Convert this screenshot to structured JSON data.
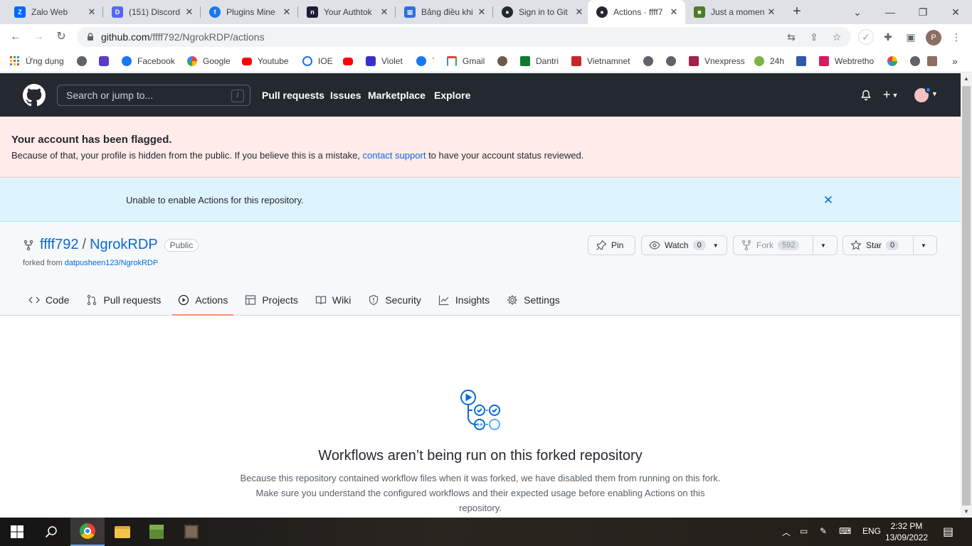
{
  "browser": {
    "tabs": [
      {
        "title": "Zalo Web",
        "icon": "zalo-icon",
        "color": "#0068ff"
      },
      {
        "title": "(151) Discord",
        "icon": "discord-icon",
        "color": "#5865f2"
      },
      {
        "title": "Plugins Mine",
        "icon": "facebook-icon",
        "color": "#1877f2"
      },
      {
        "title": "Your Authtok",
        "icon": "ngrok-icon",
        "color": "#1f1e37"
      },
      {
        "title": "Bảng điều khi",
        "icon": "dashboard-icon",
        "color": "#2f6fd8"
      },
      {
        "title": "Sign in to Git",
        "icon": "github-icon",
        "color": "#24292f"
      },
      {
        "title": "Actions · ffff7",
        "icon": "github-icon",
        "color": "#24292f"
      },
      {
        "title": "Just a momen",
        "icon": "minecraft-icon",
        "color": "#4e7a2a"
      }
    ],
    "url_host": "github.com",
    "url_path": "/ffff792/NgrokRDP/actions",
    "profile_initial": "P",
    "bookmarks": [
      {
        "label": "Ứng dụng",
        "color": "#e8453c"
      },
      {
        "label": "",
        "color": "#5f6368"
      },
      {
        "label": "",
        "color": "#5b3cc4"
      },
      {
        "label": "Facebook",
        "color": "#1877f2"
      },
      {
        "label": "Google",
        "color": "#4285f4"
      },
      {
        "label": "Youtube",
        "color": "#ff0000"
      },
      {
        "label": "IOE",
        "color": "#1a73e8"
      },
      {
        "label": "",
        "color": "#ff0000"
      },
      {
        "label": "Violet",
        "color": "#3b2fc9"
      },
      {
        "label": "`",
        "color": "#1877f2"
      },
      {
        "label": "Gmail",
        "color": "#ea4335"
      },
      {
        "label": "",
        "color": "#6d5a4a"
      },
      {
        "label": "Dantri",
        "color": "#0d7a2e"
      },
      {
        "label": "Vietnamnet",
        "color": "#c62828"
      },
      {
        "label": "",
        "color": "#5f6368"
      },
      {
        "label": "",
        "color": "#5f6368"
      },
      {
        "label": "Vnexpress",
        "color": "#9f224e"
      },
      {
        "label": "24h",
        "color": "#7cb342"
      },
      {
        "label": "",
        "color": "#2e5aa8"
      },
      {
        "label": "Webtretho",
        "color": "#d81b60"
      },
      {
        "label": "",
        "color": "#fbbc05"
      },
      {
        "label": "",
        "color": "#5f6368"
      },
      {
        "label": "",
        "color": "#8d6e63"
      }
    ]
  },
  "github": {
    "search_placeholder": "Search or jump to...",
    "search_key": "/",
    "nav": [
      "Pull requests",
      "Issues",
      "Marketplace",
      "Explore"
    ],
    "flagged_title": "Your account has been flagged.",
    "flagged_text_before": "Because of that, your profile is hidden from the public. If you believe this is a mistake,",
    "flagged_link": "contact support",
    "flagged_text_after": "to have your account status reviewed.",
    "actions_notice": "Unable to enable Actions for this repository.",
    "repo": {
      "owner": "ffff792",
      "separator": "/",
      "name": "NgrokRDP",
      "visibility": "Public",
      "forked_prefix": "forked from",
      "forked_source": "datpusheen123/NgrokRDP"
    },
    "buttons": {
      "pin": "Pin",
      "watch": "Watch",
      "watch_count": "0",
      "fork": "Fork",
      "fork_count": "592",
      "star": "Star",
      "star_count": "0"
    },
    "tabs": [
      "Code",
      "Pull requests",
      "Actions",
      "Projects",
      "Wiki",
      "Security",
      "Insights",
      "Settings"
    ],
    "selected_tab": "Actions",
    "empty": {
      "heading": "Workflows aren’t being run on this forked repository",
      "body": "Because this repository contained workflow files when it was forked, we have disabled them from running on this fork. Make sure you understand the configured workflows and their expected usage before enabling Actions on this repository."
    },
    "colors": {
      "header_bg": "#24292f",
      "link": "#0969da",
      "danger_bg": "#ffebe9",
      "info_bg": "#ddf4ff",
      "tab_underline": "#fd8c73"
    }
  },
  "taskbar": {
    "language": "ENG",
    "time": "2:32 PM",
    "date": "13/09/2022"
  }
}
